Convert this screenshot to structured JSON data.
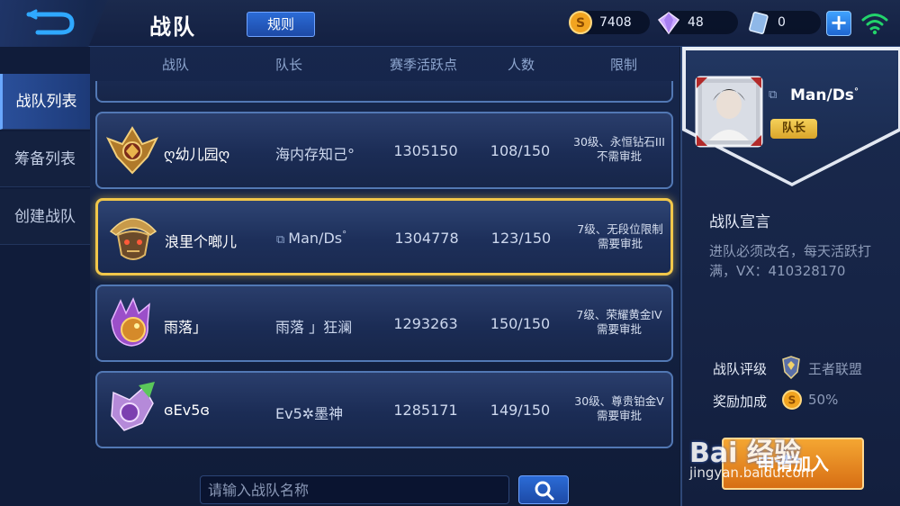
{
  "header": {
    "title": "战队",
    "rules_label": "规则",
    "currencies": [
      {
        "icon": "gold-coin-icon",
        "value": "7408"
      },
      {
        "icon": "diamond-icon",
        "value": "48"
      },
      {
        "icon": "voucher-icon",
        "value": "0"
      }
    ]
  },
  "sidebar": {
    "items": [
      {
        "label": "战队列表",
        "active": true
      },
      {
        "label": "筹备列表",
        "active": false
      },
      {
        "label": "创建战队",
        "active": false
      }
    ]
  },
  "table": {
    "columns": [
      "战队",
      "队长",
      "赛季活跃点",
      "人数",
      "限制"
    ],
    "rows": [
      {
        "emblem": "golden-eagle-emblem-icon",
        "name": "ღ幼儿园ღ",
        "leader": "海内存知己°",
        "points": "1305150",
        "count": "108/150",
        "limit_line1": "30级、永恒钻石III",
        "limit_line2": "不需审批",
        "selected": false
      },
      {
        "emblem": "tribal-mask-emblem-icon",
        "name": "浪里个啷儿",
        "leader": "Man/Ds",
        "leader_suffix": "°",
        "points": "1304778",
        "count": "123/150",
        "limit_line1": "7级、无段位限制",
        "limit_line2": "需要审批",
        "selected": true
      },
      {
        "emblem": "dragon-emblem-icon",
        "name": "雨落」",
        "leader": "雨落 」狂澜",
        "points": "1293263",
        "count": "150/150",
        "limit_line1": "7级、荣耀黄金IV",
        "limit_line2": "需要审批",
        "selected": false
      },
      {
        "emblem": "purple-crest-emblem-icon",
        "name": "ɞEv5ɞ",
        "leader": "Ev5✲墨神",
        "points": "1285171",
        "count": "149/150",
        "limit_line1": "30级、尊贵铂金V",
        "limit_line2": "需要审批",
        "selected": false
      }
    ]
  },
  "search": {
    "placeholder": "请输入战队名称"
  },
  "panel": {
    "captain_name": "Man/Ds",
    "captain_suffix": "°",
    "captain_badge": "队长",
    "declaration_title": "战队宣言",
    "declaration_text": "进队必须改名，每天活跃打满，VX：410328170",
    "rating_label": "战队评级",
    "rating_value": "王者联盟",
    "bonus_label": "奖励加成",
    "bonus_value": "50%",
    "apply_label": "申请加入"
  },
  "watermark": {
    "text": "Bai 经验",
    "url": "jingyan.baidu.com"
  },
  "colors": {
    "selected_border": "#f1c74a",
    "accent_blue": "#2b6bd6",
    "apply_orange": "#e88a22"
  }
}
